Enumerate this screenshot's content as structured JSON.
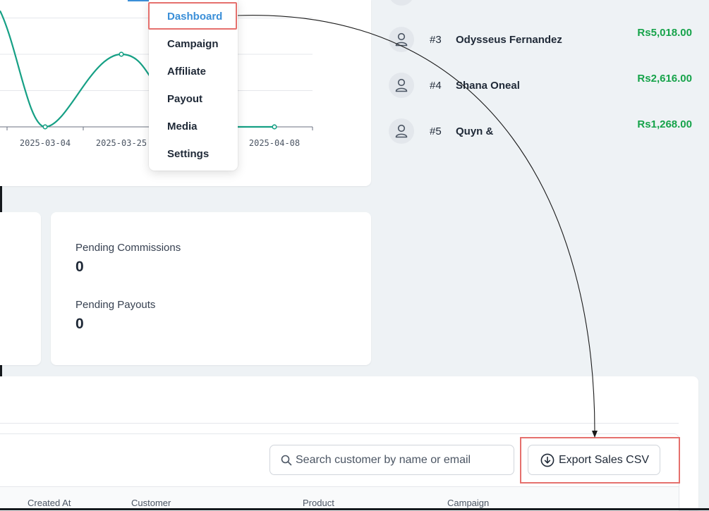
{
  "menu": {
    "items": [
      {
        "label": "Dashboard",
        "active": true
      },
      {
        "label": "Campaign"
      },
      {
        "label": "Affiliate"
      },
      {
        "label": "Payout"
      },
      {
        "label": "Media"
      },
      {
        "label": "Settings"
      }
    ]
  },
  "chart_data": {
    "type": "line",
    "x_tick_labels": [
      "2025-03-04",
      "2025-03-25",
      "2025-04-08"
    ],
    "series": [
      {
        "color": "#16a085",
        "points_visible": [
          {
            "x": "2025-03-04",
            "y": 0,
            "marker": true
          },
          {
            "x": "2025-03-25",
            "y": 2,
            "marker": true
          },
          {
            "x": "2025-04-08",
            "y": 0,
            "marker": true
          }
        ]
      }
    ],
    "grid": true
  },
  "leaderboard": {
    "rows": [
      {
        "rank": "#3",
        "name": "Odysseus Fernandez",
        "amount": "Rs5,018.00"
      },
      {
        "rank": "#4",
        "name": "Shana Oneal",
        "amount": "Rs2,616.00"
      },
      {
        "rank": "#5",
        "name": "Quyn &",
        "amount": "Rs1,268.00"
      }
    ],
    "accent_color": "#16a34a"
  },
  "stats": {
    "pending_commissions": {
      "label": "Pending Commissions",
      "value": "0"
    },
    "pending_payouts": {
      "label": "Pending Payouts",
      "value": "0"
    }
  },
  "sales": {
    "search_placeholder": "Search customer by name or email",
    "export_label": "Export Sales CSV",
    "columns": [
      "Created At",
      "Customer",
      "Product",
      "Campaign"
    ]
  },
  "colors": {
    "highlight": "#e5706d",
    "active_link": "#3b8fd8"
  }
}
